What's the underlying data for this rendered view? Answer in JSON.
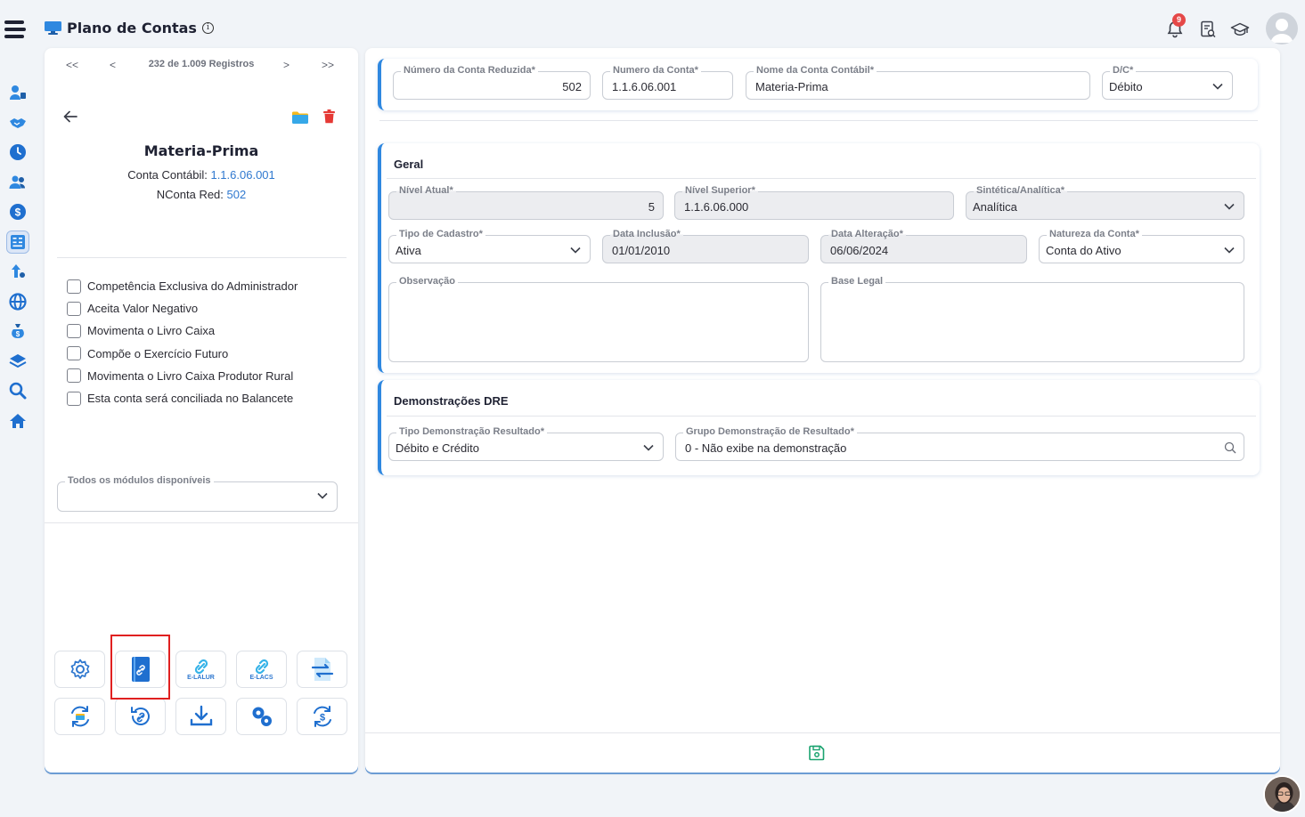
{
  "header": {
    "title": "Plano de Contas",
    "notifications_count": "9"
  },
  "left": {
    "pager": {
      "first": "<<",
      "prev": "<",
      "count": "232 de 1.009 Registros",
      "next": ">",
      "last": ">>"
    },
    "account_name": "Materia-Prima",
    "conta_contabil_label": "Conta Contábil:",
    "conta_contabil_value": "1.1.6.06.001",
    "nconta_label": "NConta Red:",
    "nconta_value": "502",
    "checkboxes": [
      "Competência Exclusiva do Administrador",
      "Aceita Valor Negativo",
      "Movimenta o Livro Caixa",
      "Compõe o Exercício Futuro",
      "Movimenta o Livro Caixa Produtor Rural",
      "Esta conta será conciliada no Balancete"
    ],
    "modules_label": "Todos os módulos disponíveis",
    "modules_value": "",
    "tools": {
      "elalur": "E-LALUR",
      "elacs": "E-LACS"
    }
  },
  "top_form": {
    "conta_reduzida_label": "Número da Conta Reduzida*",
    "conta_reduzida_value": "502",
    "numero_conta_label": "Numero da Conta*",
    "numero_conta_value": "1.1.6.06.001",
    "nome_conta_label": "Nome da Conta Contábil*",
    "nome_conta_value": "Materia-Prima",
    "dc_label": "D/C*",
    "dc_value": "Débito"
  },
  "geral": {
    "title": "Geral",
    "nivel_atual_label": "Nível Atual*",
    "nivel_atual_value": "5",
    "nivel_superior_label": "Nível Superior*",
    "nivel_superior_value": "1.1.6.06.000",
    "sintetica_label": "Sintética/Analítica*",
    "sintetica_value": "Analítica",
    "tipo_cadastro_label": "Tipo de Cadastro*",
    "tipo_cadastro_value": "Ativa",
    "data_inclusao_label": "Data Inclusão*",
    "data_inclusao_value": "01/01/2010",
    "data_alteracao_label": "Data Alteração*",
    "data_alteracao_value": "06/06/2024",
    "natureza_label": "Natureza da Conta*",
    "natureza_value": "Conta do Ativo",
    "observacao_label": "Observação",
    "base_legal_label": "Base Legal"
  },
  "dre": {
    "title": "Demonstrações DRE",
    "tipo_label": "Tipo Demonstração Resultado*",
    "tipo_value": "Débito e Crédito",
    "grupo_label": "Grupo Demonstração de Resultado*",
    "grupo_value": "0 - Não exibe na demonstração"
  },
  "colors": {
    "accent": "#2f88e0",
    "link": "#2f78cf",
    "highlight": "#e02020",
    "save": "#1aa36f"
  }
}
